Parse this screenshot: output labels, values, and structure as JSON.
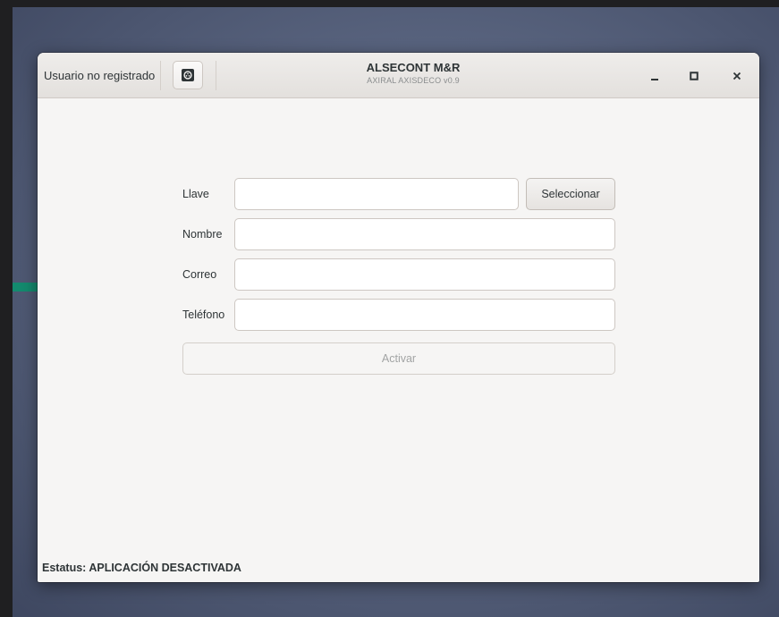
{
  "window": {
    "title": "ALSECONT M&R",
    "subtitle": "AXIRAL AXISDECO v0.9"
  },
  "header": {
    "user_label": "Usuario no registrado",
    "icon": "media-reel-icon"
  },
  "window_controls": {
    "minimize": "_",
    "maximize": "□",
    "close": "×"
  },
  "form": {
    "llave": {
      "label": "Llave",
      "value": ""
    },
    "nombre": {
      "label": "Nombre",
      "value": ""
    },
    "correo": {
      "label": "Correo",
      "value": ""
    },
    "telefono": {
      "label": "Teléfono",
      "value": ""
    },
    "select_label": "Seleccionar",
    "activate_label": "Activar"
  },
  "status": {
    "text": "Estatus: APLICACIÓN DESACTIVADA"
  },
  "colors": {
    "arrow": "#138a6e",
    "window_bg": "#f6f5f4",
    "desktop": "#5a6580"
  }
}
